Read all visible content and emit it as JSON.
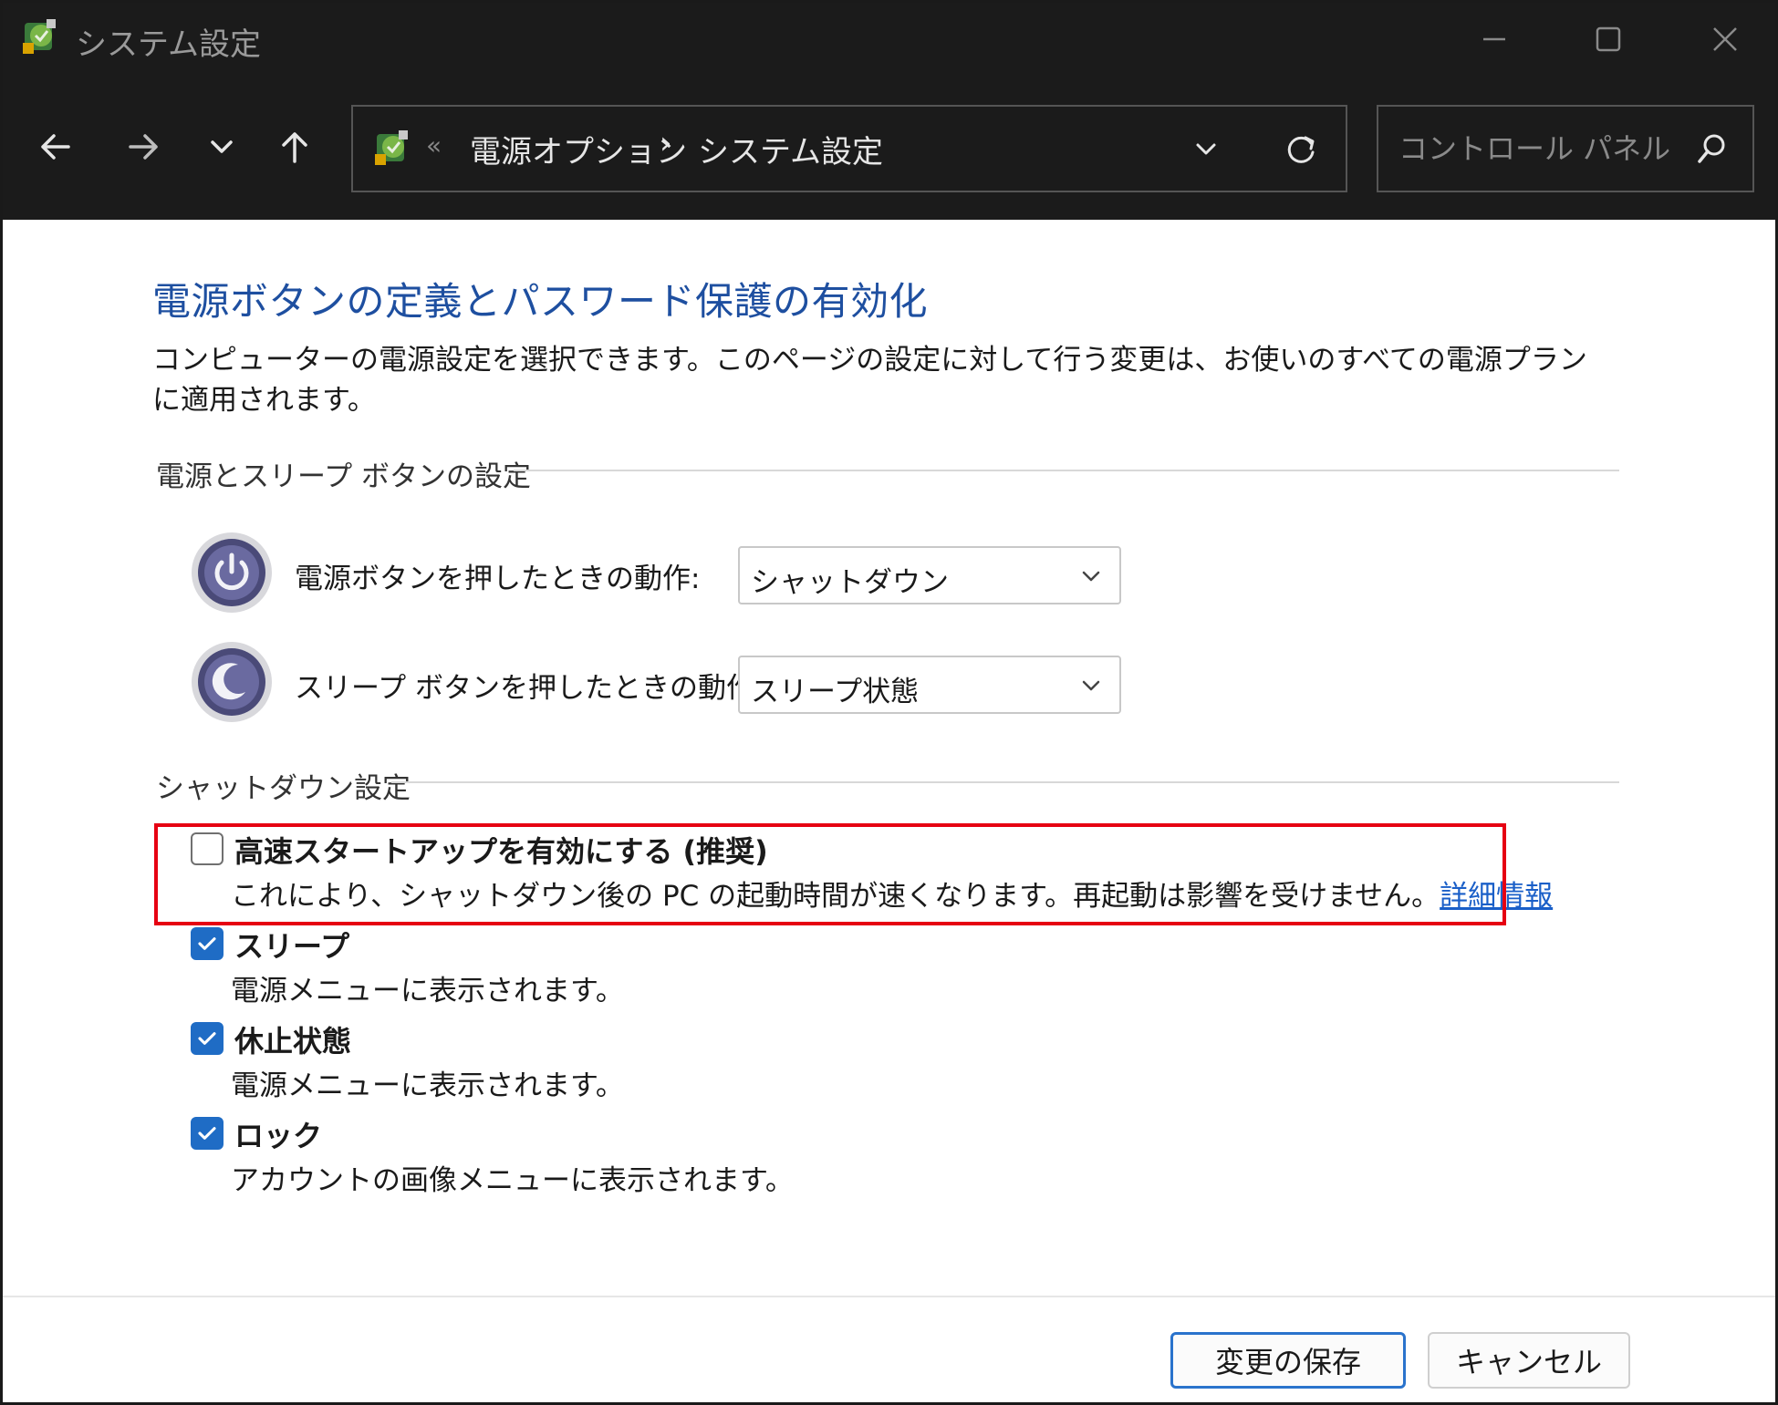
{
  "window": {
    "title": "システム設定"
  },
  "nav": {
    "address_sep": "«",
    "breadcrumb": [
      "電源オプション",
      "システム設定"
    ],
    "breadcrumb_chevron": "›",
    "search_placeholder": "コントロール パネル..."
  },
  "page": {
    "title": "電源ボタンの定義とパスワード保護の有効化",
    "description": "コンピューターの電源設定を選択できます。このページの設定に対して行う変更は、お使いのすべての電源プランに適用されます。"
  },
  "power_section": {
    "header": "電源とスリープ ボタンの設定",
    "power_button": {
      "label": "電源ボタンを押したときの動作:",
      "value": "シャットダウン"
    },
    "sleep_button": {
      "label": "スリープ ボタンを押したときの動作:",
      "value": "スリープ状態"
    }
  },
  "shutdown_section": {
    "header": "シャットダウン設定",
    "options": [
      {
        "label": "高速スタートアップを有効にする (推奨)",
        "desc": "これにより、シャットダウン後の PC の起動時間が速くなります。再起動は影響を受けません。",
        "link": "詳細情報",
        "checked": false
      },
      {
        "label": "スリープ",
        "desc": "電源メニューに表示されます。",
        "checked": true
      },
      {
        "label": "休止状態",
        "desc": "電源メニューに表示されます。",
        "checked": true
      },
      {
        "label": "ロック",
        "desc": "アカウントの画像メニューに表示されます。",
        "checked": true
      }
    ]
  },
  "footer": {
    "save_label": "変更の保存",
    "cancel_label": "キャンセル"
  },
  "colors": {
    "titlebar_bg": "#1b1b1b",
    "title_blue": "#1e4fa0",
    "checkbox_blue": "#1f6cc5",
    "highlight_red": "#e60012",
    "link_blue": "#1a5fc8"
  }
}
